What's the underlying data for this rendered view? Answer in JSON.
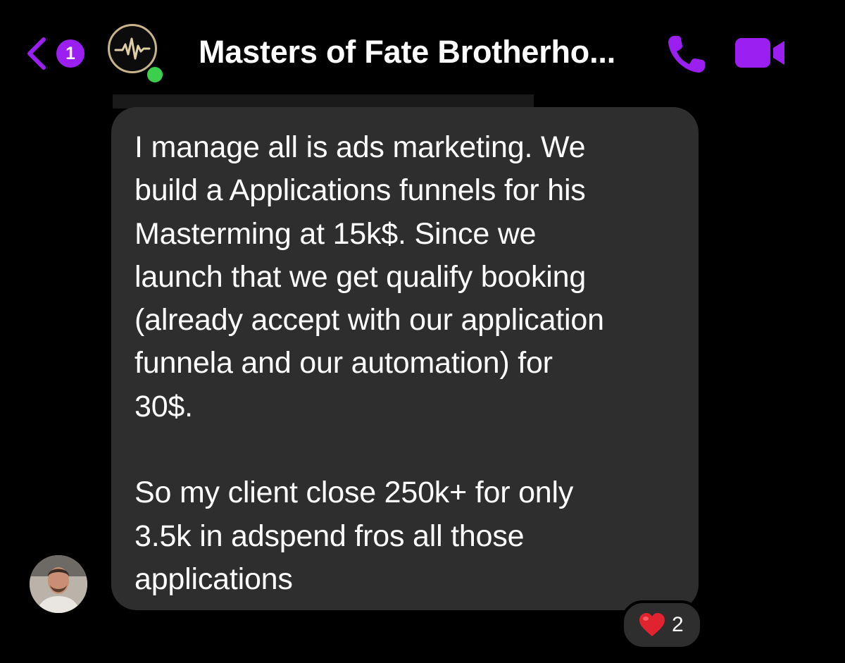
{
  "colors": {
    "accent": "#9b1ff0",
    "background": "#000000",
    "bubble": "#2e2e2e",
    "online": "#3ccf4e",
    "avatar_ring": "#c8b48a"
  },
  "header": {
    "back_icon": "chevron-left-icon",
    "unread_count": "1",
    "group_avatar_icon": "heartbeat-pulse-icon",
    "title": "Masters of Fate Brotherho...",
    "call_icon": "phone-icon",
    "video_icon": "video-camera-icon"
  },
  "message": {
    "text": "I manage all is ads marketing. We\nbuild a Applications funnels for his\nMasterming at 15k$. Since we\nlaunch that we get qualify booking\n(already accept with our application\nfunnela and our automation) for\n30$.\n\nSo my client close 250k+ for only\n3.5k in adspend fros all those\napplications"
  },
  "reaction": {
    "emoji_icon": "red-heart-icon",
    "count": "2"
  }
}
